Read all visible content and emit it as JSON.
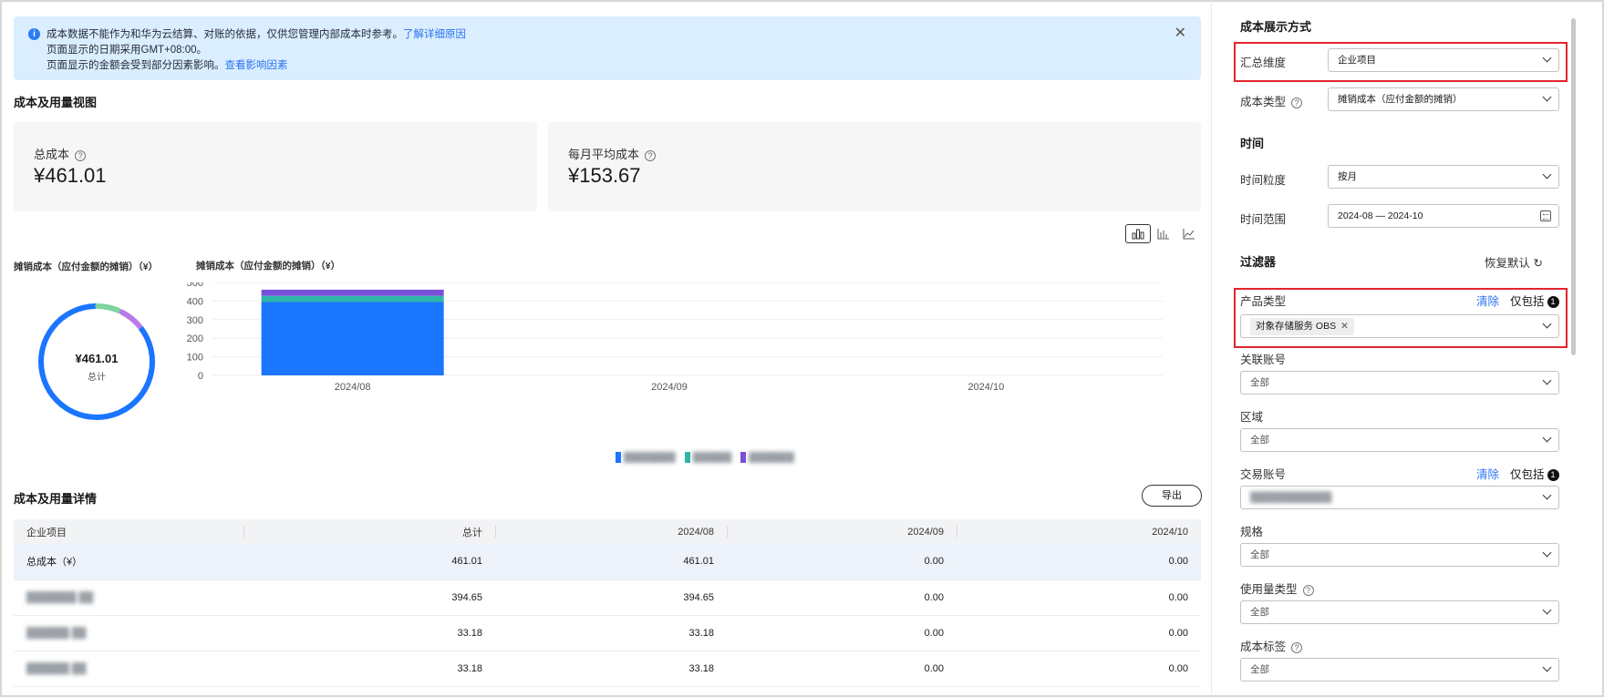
{
  "banner": {
    "line1": "成本数据不能作为和华为云结算、对账的依据，仅供您管理内部成本时参考。",
    "line1_link": "了解详细原因",
    "line2": "页面显示的日期采用GMT+08:00。",
    "line3": "页面显示的金额会受到部分因素影响。",
    "line3_link": "查看影响因素"
  },
  "section_overview": "成本及用量视图",
  "cards": {
    "total_label": "总成本",
    "total_value": "¥461.01",
    "monthly_label": "每月平均成本",
    "monthly_value": "¥153.67"
  },
  "donut": {
    "title": "摊销成本（应付金额的摊销）（¥）",
    "center_value": "¥461.01",
    "center_label": "总计"
  },
  "bar": {
    "title": "摊销成本（应付金额的摊销）（¥）"
  },
  "chart_data": [
    {
      "type": "pie",
      "title": "摊销成本（应付金额的摊销）（¥）",
      "values": [
        394.65,
        33.18,
        33.18
      ],
      "colors": [
        "#1a75ff",
        "#7ed3a0",
        "#b97ce6"
      ],
      "inner_label": "¥461.01"
    },
    {
      "type": "bar",
      "title": "摊销成本（应付金额的摊销）（¥）",
      "categories": [
        "2024/08",
        "2024/09",
        "2024/10"
      ],
      "series": [
        {
          "values": [
            394.65,
            0,
            0
          ],
          "color": "#1a75ff"
        },
        {
          "values": [
            33.18,
            0,
            0
          ],
          "color": "#2fb5a8"
        },
        {
          "values": [
            33.18,
            0,
            0
          ],
          "color": "#7a4fd8"
        }
      ],
      "ylim": [
        0,
        500
      ],
      "yticks": [
        0,
        100,
        200,
        300,
        400,
        500
      ],
      "stacked": true,
      "grid": true
    }
  ],
  "section_details": "成本及用量详情",
  "export_label": "导出",
  "table": {
    "headers": [
      "企业项目",
      "总计",
      "2024/08",
      "2024/09",
      "2024/10"
    ],
    "rows": [
      [
        "总成本（¥）",
        "461.01",
        "461.01",
        "0.00",
        "0.00"
      ],
      [
        "",
        "394.65",
        "394.65",
        "0.00",
        "0.00"
      ],
      [
        "",
        "33.18",
        "33.18",
        "0.00",
        "0.00"
      ],
      [
        "",
        "33.18",
        "33.18",
        "0.00",
        "0.00"
      ]
    ]
  },
  "side": {
    "display_title": "成本展示方式",
    "agg_label": "汇总维度",
    "agg_value": "企业项目",
    "cost_type_label": "成本类型",
    "cost_type_value": "摊销成本（应付金额的摊销）",
    "time_title": "时间",
    "granularity_label": "时间粒度",
    "granularity_value": "按月",
    "range_label": "时间范围",
    "range_value": "2024-08 — 2024-10",
    "filter_title": "过滤器",
    "reset_label": "恢复默认",
    "product_label": "产品类型",
    "clear_label": "清除",
    "include_label": "仅包括",
    "include_count": "1",
    "product_tag": "对象存储服务 OBS",
    "linked_label": "关联账号",
    "region_label": "区域",
    "trade_label": "交易账号",
    "spec_label": "规格",
    "usage_label": "使用量类型",
    "tag_label": "成本标签",
    "all_value": "全部"
  }
}
